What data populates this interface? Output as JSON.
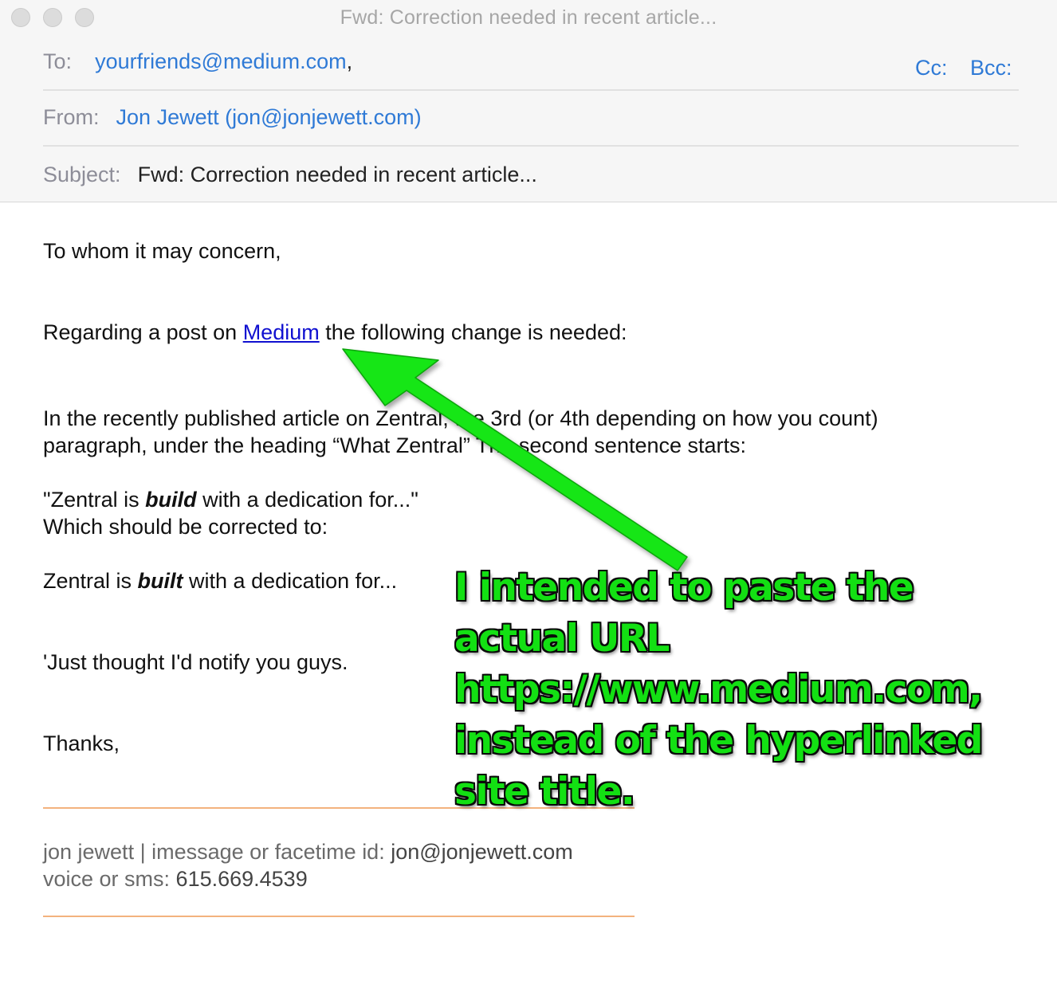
{
  "window": {
    "title": "Fwd: Correction needed in recent article..."
  },
  "header": {
    "to_label": "To:",
    "to_value": "yourfriends@medium.com",
    "to_sep": ",",
    "cc_label": "Cc:",
    "bcc_label": "Bcc:",
    "from_label": "From:",
    "from_value": "Jon Jewett (jon@jonjewett.com)",
    "subject_label": "Subject:",
    "subject_value": "Fwd: Correction needed in recent article..."
  },
  "body": {
    "greeting": "To whom it may concern,",
    "regarding_pre": "Regarding a post on ",
    "regarding_link": "Medium",
    "regarding_post": " the following change is needed:",
    "para1_line1": "In the recently published article on Zentral, the 3rd (or 4th depending on how you count)",
    "para1_line2": "paragraph, under the heading “What Zentral” The second sentence starts:",
    "quote_pre": "\"Zentral is ",
    "quote_bold": "build",
    "quote_post": " with a dedication for...\"",
    "correct_intro": "Which should be corrected to:",
    "fix_pre": "Zentral is ",
    "fix_bold": "built",
    "fix_post": " with a dedication for...",
    "notify": "'Just thought I'd notify you guys.",
    "thanks": "Thanks,"
  },
  "signature": {
    "line1_pre": "jon jewett | imessage or facetime id: ",
    "line1_email": "jon@jonjewett.com",
    "line2_pre": "voice or sms: ",
    "line2_phone": "615.669.4539"
  },
  "annotation": {
    "text": "I intended to paste the actual URL https://www.medium.com, instead of the hyperlinked site title.",
    "color": "#13e013"
  }
}
